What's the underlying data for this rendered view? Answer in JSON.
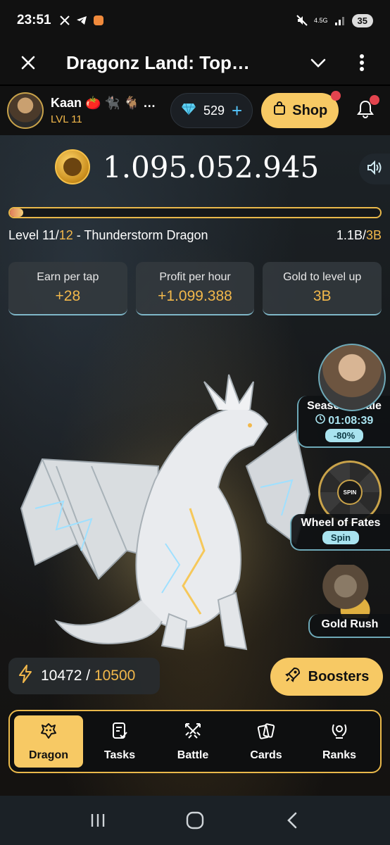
{
  "status_bar": {
    "time": "23:51",
    "network": "4.5G",
    "battery": "35",
    "notification_icons": [
      "x-icon",
      "telegram-icon",
      "app-icon"
    ]
  },
  "app_bar": {
    "title": "Dragonz Land: Top…",
    "close_icon": "close-icon",
    "chevron_icon": "chevron-down-icon",
    "menu_icon": "more-vertical-icon"
  },
  "header": {
    "username": "Kaan 🍅 🐈‍⬛ 🐐 …",
    "level": "LVL 11",
    "gems": "529",
    "gems_plus": "+",
    "shop_label": "Shop"
  },
  "balance": {
    "value": "1.095.052.945"
  },
  "level": {
    "text_prefix": "Level 11/",
    "text_target": "12",
    "text_suffix": " - Thunderstorm Dragon",
    "progress_current": "1.1B",
    "progress_sep": "/",
    "progress_total": "3B",
    "progress_fraction": 0.037
  },
  "stats": [
    {
      "label": "Earn per tap",
      "value": "+28"
    },
    {
      "label": "Profit per hour",
      "value": "+1.099.388"
    },
    {
      "label": "Gold to level up",
      "value": "3B"
    }
  ],
  "promos": {
    "seasonal_sale": {
      "title": "Seasonal sale",
      "timer": "01:08:39",
      "discount": "-80%"
    },
    "wheel": {
      "title": "Wheel of Fates",
      "action": "Spin",
      "center_label": "SPIN"
    },
    "gold_rush": {
      "title": "Gold Rush"
    }
  },
  "energy": {
    "current": "10472",
    "separator": " / ",
    "max": "10500"
  },
  "boosters_label": "Boosters",
  "nav": [
    {
      "label": "Dragon",
      "icon": "dragon-icon",
      "active": true
    },
    {
      "label": "Tasks",
      "icon": "tasks-icon",
      "active": false
    },
    {
      "label": "Battle",
      "icon": "battle-icon",
      "active": false
    },
    {
      "label": "Cards",
      "icon": "cards-icon",
      "active": false
    },
    {
      "label": "Ranks",
      "icon": "ranks-icon",
      "active": false
    }
  ],
  "colors": {
    "accent_gold": "#f7c964",
    "gold_text": "#f2b84b",
    "cyan": "#6ea9b8",
    "badge_red": "#e3444e"
  }
}
